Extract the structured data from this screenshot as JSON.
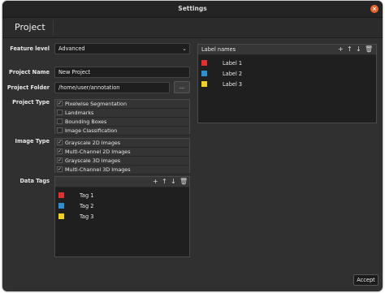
{
  "window": {
    "title": "Settings"
  },
  "header": {
    "title": "Project"
  },
  "feature_level": {
    "label": "Feature level",
    "value": "Advanced"
  },
  "project_name": {
    "label": "Project Name",
    "value": "New Project"
  },
  "project_folder": {
    "label": "Project Folder",
    "value": "/home/user/annotation",
    "browse_label": "..."
  },
  "project_type": {
    "label": "Project Type",
    "options": [
      {
        "label": "Pixelwise Segmentation",
        "checked": true
      },
      {
        "label": "Landmarks",
        "checked": false
      },
      {
        "label": "Bounding Boxes",
        "checked": false
      },
      {
        "label": "Image Classification",
        "checked": false
      }
    ]
  },
  "image_type": {
    "label": "Image Type",
    "options": [
      {
        "label": "Grayscale 2D Images",
        "checked": true
      },
      {
        "label": "Multi-Channel 2D Images",
        "checked": true
      },
      {
        "label": "Grayscale 3D Images",
        "checked": true
      },
      {
        "label": "Multi-Channel 3D Images",
        "checked": true
      }
    ]
  },
  "data_tags": {
    "label": "Data Tags",
    "tools": [
      "add-icon",
      "arrow-up-icon",
      "arrow-down-icon",
      "trash-icon"
    ],
    "items": [
      {
        "label": "Tag 1",
        "color": "#e03030"
      },
      {
        "label": "Tag 2",
        "color": "#2b8fd0"
      },
      {
        "label": "Tag 3",
        "color": "#f0d020"
      }
    ]
  },
  "label_names": {
    "title": "Label names",
    "tools": [
      "add-icon",
      "arrow-up-icon",
      "arrow-down-icon",
      "trash-icon"
    ],
    "items": [
      {
        "label": "Label 1",
        "color": "#e03030"
      },
      {
        "label": "Label 2",
        "color": "#2b8fd0"
      },
      {
        "label": "Label 3",
        "color": "#f0d020"
      }
    ]
  },
  "footer": {
    "accept_label": "Accept"
  }
}
